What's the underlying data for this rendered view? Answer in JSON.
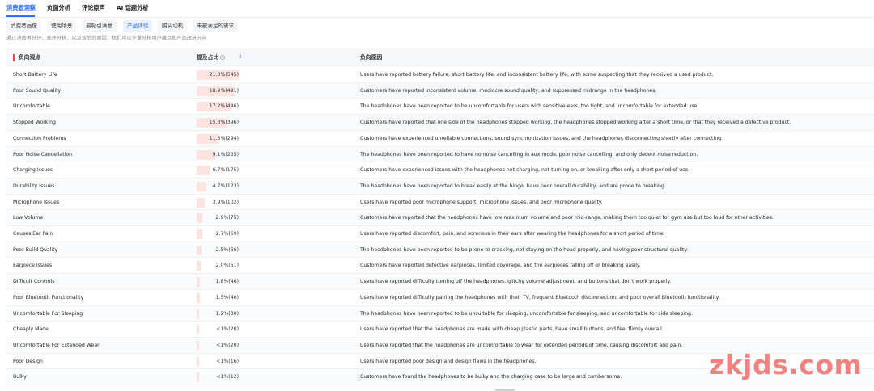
{
  "top_tabs": [
    "消费者洞察",
    "负面分析",
    "评论原声",
    "AI 话题分析"
  ],
  "sub_tabs": [
    "消费者画像",
    "使用场景",
    "最吸引满意",
    "产品体验",
    "购买动机",
    "未被满足的需求"
  ],
  "active_sub_tab": "产品体验",
  "description": "通过消费者好评、差评分析，以及背后的原因，我们可以全量分析用户痛点和产品改进方向",
  "table": {
    "headers": {
      "negative_point": "负向观点",
      "share": "提及占比",
      "reason": "负向原因"
    },
    "rows": [
      {
        "name": "Short Battery Life",
        "pct": "21.0%(545)",
        "share": 21.0,
        "reason": "Users have reported battery failure, short battery life, and inconsistent battery life, with some suspecting that they received a used product."
      },
      {
        "name": "Poor Sound Quality",
        "pct": "18.9%(491)",
        "share": 18.9,
        "reason": "Customers have reported inconsistent volume, mediocre sound quality, and suppressed midrange in the headphones."
      },
      {
        "name": "Uncomfortable",
        "pct": "17.2%(446)",
        "share": 17.2,
        "reason": "The headphones have been reported to be uncomfortable for users with sensitive ears, too tight, and uncomfortable for extended use."
      },
      {
        "name": "Stopped Working",
        "pct": "15.3%(396)",
        "share": 15.3,
        "reason": "Customers have reported that one side of the headphones stopped working, the headphones stopped working after a short time, or that they received a defective product."
      },
      {
        "name": "Connection Problems",
        "pct": "11.3%(294)",
        "share": 11.3,
        "reason": "Customers have experienced unreliable connections, sound synchronization issues, and the headphones disconnecting shortly after connecting."
      },
      {
        "name": "Poor Noise Cancellation",
        "pct": "9.1%(235)",
        "share": 9.1,
        "reason": "The headphones have been reported to have no noise cancelling in aux mode, poor noise cancelling, and only decent noise reduction."
      },
      {
        "name": "Charging Issues",
        "pct": "6.7%(175)",
        "share": 6.7,
        "reason": "Customers have experienced issues with the headphones not charging, not turning on, or breaking after only a short period of use."
      },
      {
        "name": "Durability Issues",
        "pct": "4.7%(123)",
        "share": 4.7,
        "reason": "The headphones have been reported to break easily at the hinge, have poor overall durability, and are prone to breaking."
      },
      {
        "name": "Microphone Issues",
        "pct": "3.9%(102)",
        "share": 3.9,
        "reason": "Users have reported poor microphone support, microphone issues, and poor microphone quality."
      },
      {
        "name": "Low Volume",
        "pct": "2.9%(75)",
        "share": 2.9,
        "reason": "Customers have reported that the headphones have low maximum volume and poor mid-range, making them too quiet for gym use but too loud for other activities."
      },
      {
        "name": "Causes Ear Pain",
        "pct": "2.7%(69)",
        "share": 2.7,
        "reason": "Users have reported discomfort, pain, and soreness in their ears after wearing the headphones for a short period of time."
      },
      {
        "name": "Poor Build Quality",
        "pct": "2.5%(66)",
        "share": 2.5,
        "reason": "The headphones have been reported to be prone to cracking, not staying on the head properly, and having poor structural quality."
      },
      {
        "name": "Earpiece Issues",
        "pct": "2.0%(51)",
        "share": 2.0,
        "reason": "Customers have reported defective earpieces, limited coverage, and the earpieces falling off or breaking easily."
      },
      {
        "name": "Difficult Controls",
        "pct": "1.8%(46)",
        "share": 1.8,
        "reason": "Users have reported difficulty turning off the headphones, glitchy volume adjustment, and buttons that don't work properly."
      },
      {
        "name": "Poor Bluetooth Functionality",
        "pct": "1.5%(40)",
        "share": 1.5,
        "reason": "Users have reported difficulty pairing the headphones with their TV, frequent Bluetooth disconnection, and poor overall Bluetooth functionality."
      },
      {
        "name": "Uncomfortable For Sleeping",
        "pct": "1.2%(30)",
        "share": 1.2,
        "reason": "The headphones have been reported to be unsuitable for sleeping, uncomfortable for sleeping, and uncomfortable for side sleeping."
      },
      {
        "name": "Cheaply Made",
        "pct": "<1%(20)",
        "share": 0.8,
        "reason": "Users have reported that the headphones are made with cheap plastic parts, have small buttons, and feel flimsy overall."
      },
      {
        "name": "Uncomfortable For Extended Wear",
        "pct": "<1%(20)",
        "share": 0.8,
        "reason": "Users have reported that the headphones are uncomfortable to wear for extended periods of time, causing discomfort and pain."
      },
      {
        "name": "Poor Design",
        "pct": "<1%(16)",
        "share": 0.6,
        "reason": "Users have reported poor design and design flaws in the headphones."
      },
      {
        "name": "Bulky",
        "pct": "<1%(12)",
        "share": 0.5,
        "reason": "Customers have found the headphones to be bulky and the charging case to be large and cumbersome."
      }
    ]
  },
  "watermark": "zkjds.com",
  "colors": {
    "accent": "#2f6bff",
    "bar": "#fde4e1",
    "marker": "#e14b4b",
    "watermark": "#ef6f6c"
  }
}
